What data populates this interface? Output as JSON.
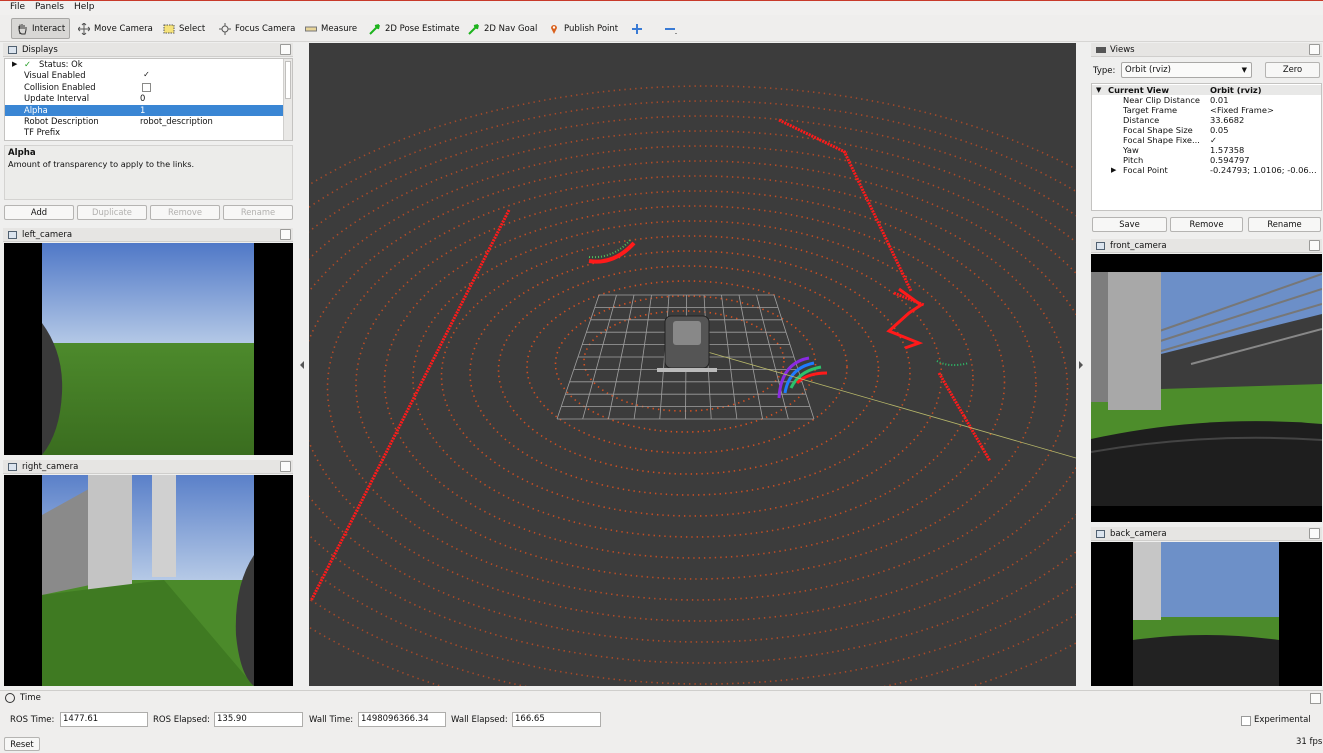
{
  "menubar": {
    "items": [
      "File",
      "Panels",
      "Help"
    ]
  },
  "toolbar": {
    "tools": [
      {
        "label": "Interact",
        "icon": "hand-icon"
      },
      {
        "label": "Move Camera",
        "icon": "move-camera-icon"
      },
      {
        "label": "Select",
        "icon": "select-icon"
      },
      {
        "label": "Focus Camera",
        "icon": "focus-camera-icon"
      },
      {
        "label": "Measure",
        "icon": "ruler-icon"
      },
      {
        "label": "2D Pose Estimate",
        "icon": "pose-arrow-icon"
      },
      {
        "label": "2D Nav Goal",
        "icon": "nav-goal-arrow-icon"
      },
      {
        "label": "Publish Point",
        "icon": "map-pin-icon"
      }
    ]
  },
  "displays": {
    "title": "Displays",
    "rows": [
      {
        "key": "Status: Ok",
        "value": ""
      },
      {
        "key": "Visual Enabled",
        "value": "✓"
      },
      {
        "key": "Collision Enabled",
        "value": ""
      },
      {
        "key": "Update Interval",
        "value": "0"
      },
      {
        "key": "Alpha",
        "value": "1"
      },
      {
        "key": "Robot Description",
        "value": "robot_description"
      },
      {
        "key": "TF Prefix",
        "value": ""
      }
    ],
    "desc_title": "Alpha",
    "desc_text": "Amount of transparency to apply to the links.",
    "buttons": [
      "Add",
      "Duplicate",
      "Remove",
      "Rename"
    ]
  },
  "cameras": {
    "left": "left_camera",
    "right": "right_camera",
    "front": "front_camera",
    "back": "back_camera"
  },
  "views": {
    "title": "Views",
    "type_label": "Type:",
    "type_value": "Orbit (rviz)",
    "zero_label": "Zero",
    "current_view_label": "Current View",
    "current_view_value": "Orbit (rviz)",
    "rows": [
      {
        "key": "Near Clip Distance",
        "value": "0.01"
      },
      {
        "key": "Target Frame",
        "value": "<Fixed Frame>"
      },
      {
        "key": "Distance",
        "value": "33.6682"
      },
      {
        "key": "Focal Shape Size",
        "value": "0.05"
      },
      {
        "key": "Focal Shape Fixe...",
        "value": "✓"
      },
      {
        "key": "Yaw",
        "value": "1.57358"
      },
      {
        "key": "Pitch",
        "value": "0.594797"
      },
      {
        "key": "Focal Point",
        "value": "-0.24793; 1.0106; -0.06..."
      }
    ],
    "buttons": [
      "Save",
      "Remove",
      "Rename"
    ]
  },
  "time": {
    "title": "Time",
    "ros_time_label": "ROS Time:",
    "ros_time": "1477.61",
    "ros_elapsed_label": "ROS Elapsed:",
    "ros_elapsed": "135.90",
    "wall_time_label": "Wall Time:",
    "wall_time": "1498096366.34",
    "wall_elapsed_label": "Wall Elapsed:",
    "wall_elapsed": "166.65",
    "experimental_label": "Experimental",
    "reset_label": "Reset",
    "fps": "31 fps"
  },
  "colors": {
    "laser": "#e8531e",
    "obstacle": "#ff1a1a",
    "grid": "#a0a0a0",
    "viewport_bg": "#3c3c3c",
    "selection": "#3a86d4"
  }
}
